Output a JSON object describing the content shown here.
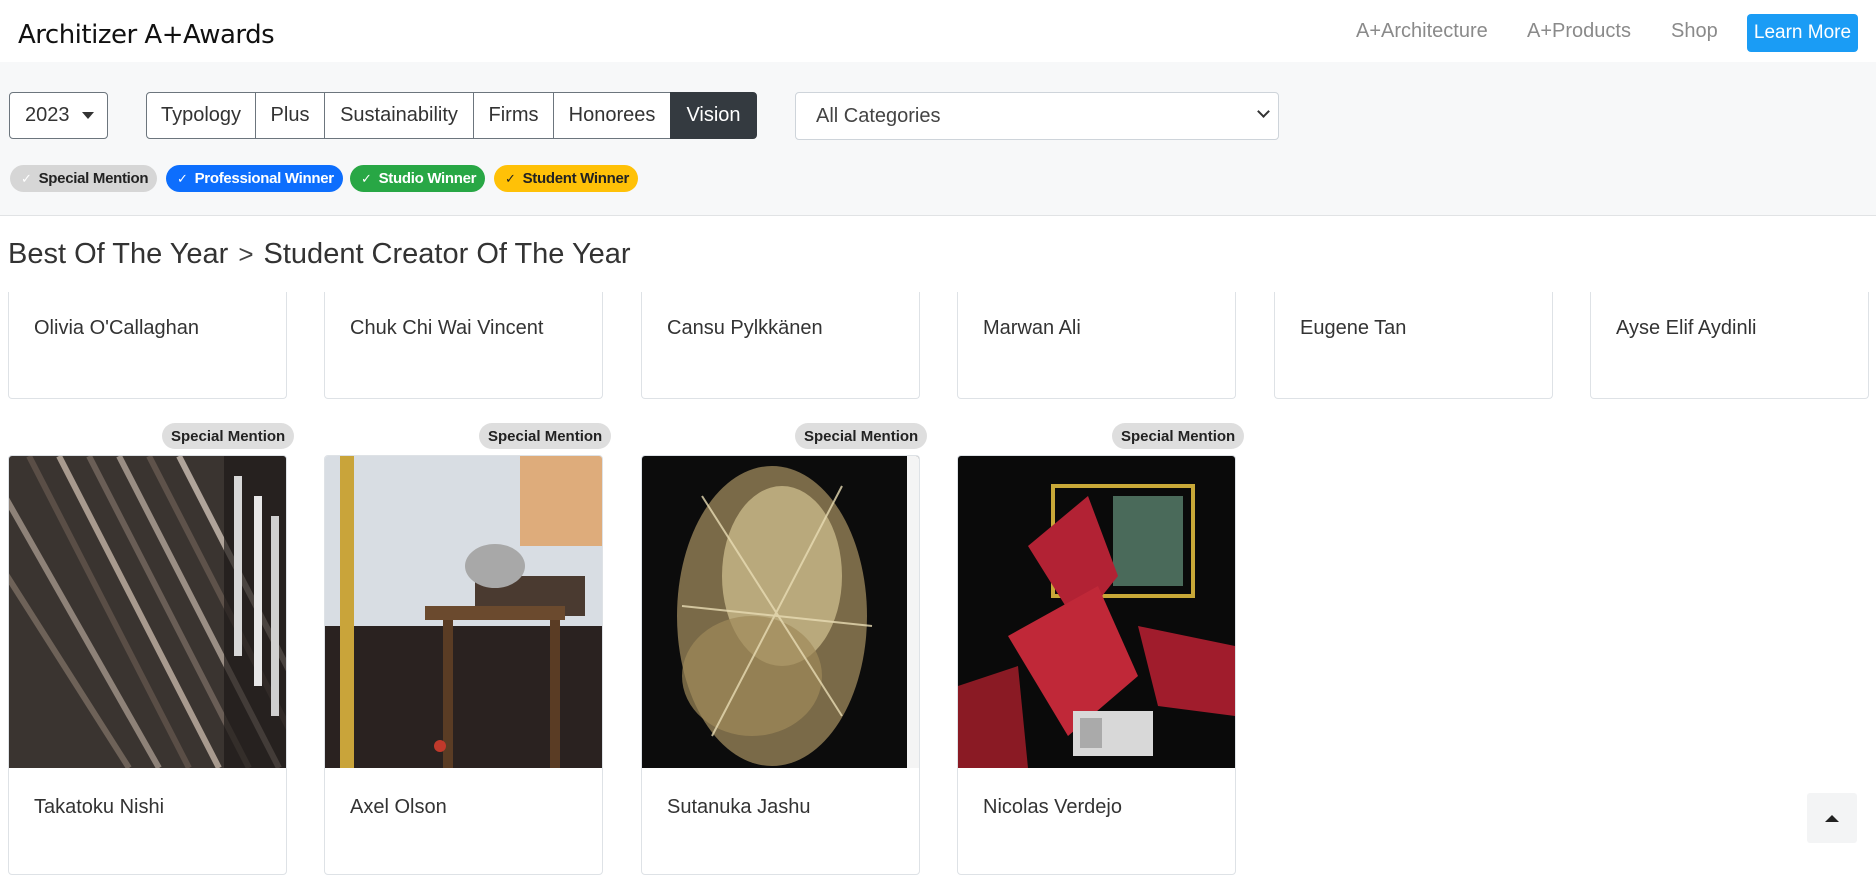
{
  "header": {
    "logo": "Architizer A+Awards",
    "nav": [
      "A+Architecture",
      "A+Products",
      "Shop"
    ],
    "learn_more": "Learn More"
  },
  "filters": {
    "year": "2023",
    "tabs": [
      "Typology",
      "Plus",
      "Sustainability",
      "Firms",
      "Honorees",
      "Vision"
    ],
    "active_tab": "Vision",
    "category": "All Categories",
    "legend": [
      {
        "label": "Special Mention",
        "color": "#d6d6d6"
      },
      {
        "label": "Professional Winner",
        "color": "#0d6efd"
      },
      {
        "label": "Studio Winner",
        "color": "#28a745"
      },
      {
        "label": "Student Winner",
        "color": "#ffc107"
      }
    ]
  },
  "breadcrumb": {
    "parent": "Best Of The Year",
    "separator": ">",
    "current": "Student Creator Of The Year"
  },
  "top_row": [
    "Olivia O'Callaghan",
    "Chuk Chi Wai Vincent",
    "Cansu Pylkkänen",
    "Marwan Ali",
    "Eugene Tan",
    "Ayse Elif Aydinli"
  ],
  "cards": [
    {
      "badge": "Special Mention",
      "name": "Takatoku Nishi"
    },
    {
      "badge": "Special Mention",
      "name": "Axel Olson"
    },
    {
      "badge": "Special Mention",
      "name": "Sutanuka Jashu"
    },
    {
      "badge": "Special Mention",
      "name": "Nicolas Verdejo"
    }
  ],
  "colors": {
    "accent": "#1a9cf5",
    "active_tab": "#343a40"
  }
}
